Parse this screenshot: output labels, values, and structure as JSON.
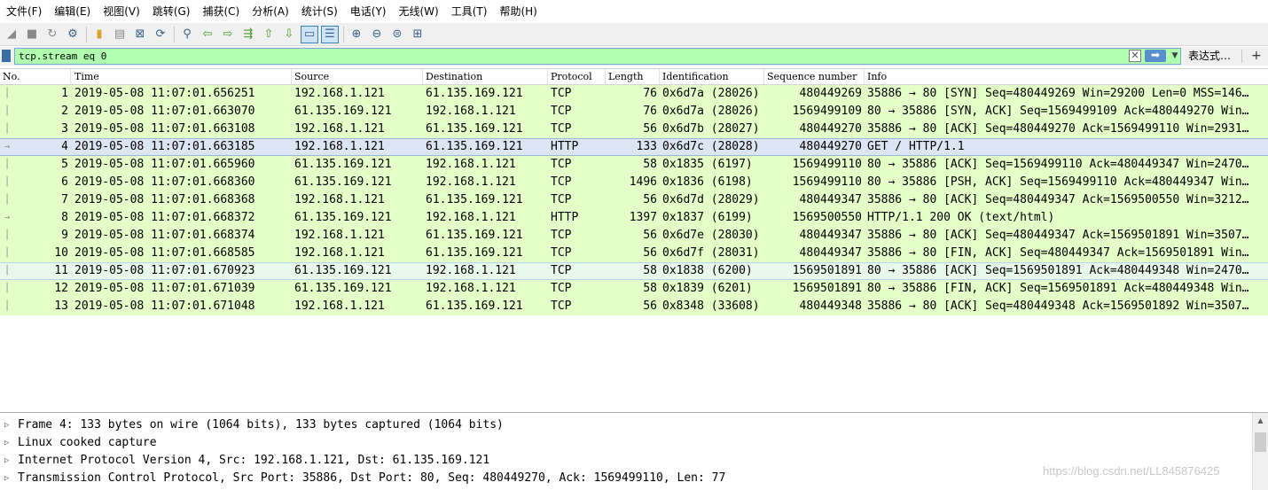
{
  "menu": [
    "文件(F)",
    "编辑(E)",
    "视图(V)",
    "跳转(G)",
    "捕获(C)",
    "分析(A)",
    "统计(S)",
    "电话(Y)",
    "无线(W)",
    "工具(T)",
    "帮助(H)"
  ],
  "toolbar_icons": [
    "shark-fin-start-icon",
    "stop-icon",
    "restart-icon",
    "capture-options-icon",
    "open-file-icon",
    "save-file-icon",
    "close-file-icon",
    "reload-icon",
    "find-icon",
    "back-icon",
    "forward-icon",
    "go-to-packet-icon",
    "first-packet-icon",
    "last-packet-icon",
    "autoscroll-icon",
    "colorize-icon",
    "zoom-in-icon",
    "zoom-out-icon",
    "normal-size-icon",
    "resize-columns-icon"
  ],
  "filter": {
    "value": "tcp.stream eq 0",
    "expression_label": "表达式…",
    "add_label": "+",
    "bg_color": "#afffaf"
  },
  "columns": [
    "No.",
    "Time",
    "Source",
    "Destination",
    "Protocol",
    "Length",
    "Identification",
    "Sequence number",
    "Info"
  ],
  "packets": [
    {
      "no": "1",
      "time": "2019-05-08 11:07:01.656251",
      "src": "192.168.1.121",
      "dst": "61.135.169.121",
      "proto": "TCP",
      "len": "76",
      "ident": "0x6d7a (28026)",
      "seq": "480449269",
      "info": "35886 → 80 [SYN] Seq=480449269 Win=29200 Len=0 MSS=146…"
    },
    {
      "no": "2",
      "time": "2019-05-08 11:07:01.663070",
      "src": "61.135.169.121",
      "dst": "192.168.1.121",
      "proto": "TCP",
      "len": "76",
      "ident": "0x6d7a (28026)",
      "seq": "1569499109",
      "info": "80 → 35886 [SYN, ACK] Seq=1569499109 Ack=480449270 Win…"
    },
    {
      "no": "3",
      "time": "2019-05-08 11:07:01.663108",
      "src": "192.168.1.121",
      "dst": "61.135.169.121",
      "proto": "TCP",
      "len": "56",
      "ident": "0x6d7b (28027)",
      "seq": "480449270",
      "info": "35886 → 80 [ACK] Seq=480449270 Ack=1569499110 Win=2931…"
    },
    {
      "no": "4",
      "time": "2019-05-08 11:07:01.663185",
      "src": "192.168.1.121",
      "dst": "61.135.169.121",
      "proto": "HTTP",
      "len": "133",
      "ident": "0x6d7c (28028)",
      "seq": "480449270",
      "info": "GET / HTTP/1.1"
    },
    {
      "no": "5",
      "time": "2019-05-08 11:07:01.665960",
      "src": "61.135.169.121",
      "dst": "192.168.1.121",
      "proto": "TCP",
      "len": "58",
      "ident": "0x1835 (6197)",
      "seq": "1569499110",
      "info": "80 → 35886 [ACK] Seq=1569499110 Ack=480449347 Win=2470…"
    },
    {
      "no": "6",
      "time": "2019-05-08 11:07:01.668360",
      "src": "61.135.169.121",
      "dst": "192.168.1.121",
      "proto": "TCP",
      "len": "1496",
      "ident": "0x1836 (6198)",
      "seq": "1569499110",
      "info": "80 → 35886 [PSH, ACK] Seq=1569499110 Ack=480449347 Win…"
    },
    {
      "no": "7",
      "time": "2019-05-08 11:07:01.668368",
      "src": "192.168.1.121",
      "dst": "61.135.169.121",
      "proto": "TCP",
      "len": "56",
      "ident": "0x6d7d (28029)",
      "seq": "480449347",
      "info": "35886 → 80 [ACK] Seq=480449347 Ack=1569500550 Win=3212…"
    },
    {
      "no": "8",
      "time": "2019-05-08 11:07:01.668372",
      "src": "61.135.169.121",
      "dst": "192.168.1.121",
      "proto": "HTTP",
      "len": "1397",
      "ident": "0x1837 (6199)",
      "seq": "1569500550",
      "info": "HTTP/1.1 200 OK  (text/html)"
    },
    {
      "no": "9",
      "time": "2019-05-08 11:07:01.668374",
      "src": "192.168.1.121",
      "dst": "61.135.169.121",
      "proto": "TCP",
      "len": "56",
      "ident": "0x6d7e (28030)",
      "seq": "480449347",
      "info": "35886 → 80 [ACK] Seq=480449347 Ack=1569501891 Win=3507…"
    },
    {
      "no": "10",
      "time": "2019-05-08 11:07:01.668585",
      "src": "192.168.1.121",
      "dst": "61.135.169.121",
      "proto": "TCP",
      "len": "56",
      "ident": "0x6d7f (28031)",
      "seq": "480449347",
      "info": "35886 → 80 [FIN, ACK] Seq=480449347 Ack=1569501891 Win…"
    },
    {
      "no": "11",
      "time": "2019-05-08 11:07:01.670923",
      "src": "61.135.169.121",
      "dst": "192.168.1.121",
      "proto": "TCP",
      "len": "58",
      "ident": "0x1838 (6200)",
      "seq": "1569501891",
      "info": "80 → 35886 [ACK] Seq=1569501891 Ack=480449348 Win=2470…"
    },
    {
      "no": "12",
      "time": "2019-05-08 11:07:01.671039",
      "src": "61.135.169.121",
      "dst": "192.168.1.121",
      "proto": "TCP",
      "len": "58",
      "ident": "0x1839 (6201)",
      "seq": "1569501891",
      "info": "80 → 35886 [FIN, ACK] Seq=1569501891 Ack=480449348 Win…"
    },
    {
      "no": "13",
      "time": "2019-05-08 11:07:01.671048",
      "src": "192.168.1.121",
      "dst": "61.135.169.121",
      "proto": "TCP",
      "len": "56",
      "ident": "0x8348 (33608)",
      "seq": "480449348",
      "info": "35886 → 80 [ACK] Seq=480449348 Ack=1569501892 Win=3507…"
    }
  ],
  "selected_packet": "4",
  "details": [
    "Frame 4: 133 bytes on wire (1064 bits), 133 bytes captured (1064 bits)",
    "Linux cooked capture",
    "Internet Protocol Version 4, Src: 192.168.1.121, Dst: 61.135.169.121",
    "Transmission Control Protocol, Src Port: 35886, Dst Port: 80, Seq: 480449270, Ack: 1569499110, Len: 77"
  ],
  "watermark": "https://blog.csdn.net/LL845876425",
  "colors": {
    "tcp_row": "#e4ffc7",
    "selected_row": "#dbe6f2",
    "filter_valid": "#afffaf"
  }
}
